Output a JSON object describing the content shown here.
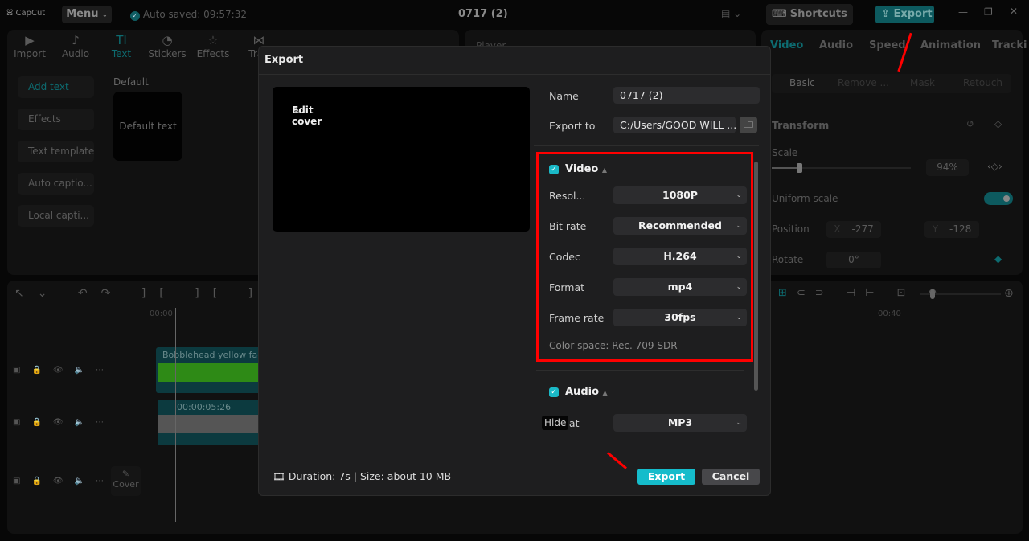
{
  "app": {
    "logo": "CapCut",
    "menu": "Menu",
    "autosave": "Auto saved: 09:57:32",
    "title": "0717 (2)",
    "shortcuts": "Shortcuts",
    "export": "Export",
    "accent": "#1ab9c7"
  },
  "toolbar": [
    {
      "label": "Import",
      "icon": "▶"
    },
    {
      "label": "Audio",
      "icon": "♪"
    },
    {
      "label": "Text",
      "icon": "TI"
    },
    {
      "label": "Stickers",
      "icon": "◔"
    },
    {
      "label": "Effects",
      "icon": "☆"
    },
    {
      "label": "Tran",
      "icon": "⋈"
    }
  ],
  "sidebar": [
    "Add text",
    "Effects",
    "Text template",
    "Auto captio...",
    "Local capti..."
  ],
  "text_panel": {
    "heading": "Default",
    "preset": "Default text"
  },
  "player": {
    "label": "Player"
  },
  "right": {
    "tabs": [
      "Video",
      "Audio",
      "Speed",
      "Animation",
      "Tracki"
    ],
    "subtabs": [
      "Basic",
      "Remove ...",
      "Mask",
      "Retouch"
    ],
    "transform": "Transform",
    "scale_label": "Scale",
    "scale_value": "94%",
    "scale": 0.94,
    "uniform_label": "Uniform scale",
    "uniform_on": true,
    "position_label": "Position",
    "x_label": "X",
    "x": "-277",
    "y_label": "Y",
    "y": "-128",
    "rotate_label": "Rotate",
    "rotate": "0°"
  },
  "timeline": {
    "time_start": "00:00",
    "time_40": "00:40",
    "clip1": "Bobblehead yellow fac",
    "clip2_time": "00:00:05:26",
    "cover": "Cover"
  },
  "dialog": {
    "title": "Export",
    "edit_cover": "Edit cover",
    "name_label": "Name",
    "name": "0717 (2)",
    "export_to_label": "Export to",
    "export_to": "C:/Users/GOOD WILL ...",
    "video": {
      "title": "Video",
      "enabled": true,
      "rows": [
        {
          "label": "Resol...",
          "value": "1080P"
        },
        {
          "label": "Bit rate",
          "value": "Recommended"
        },
        {
          "label": "Codec",
          "value": "H.264"
        },
        {
          "label": "Format",
          "value": "mp4"
        },
        {
          "label": "Frame rate",
          "value": "30fps"
        }
      ],
      "color_space": "Color space: Rec. 709 SDR"
    },
    "audio": {
      "title": "Audio",
      "enabled": true,
      "format_label": "nat",
      "format": "MP3",
      "tooltip": "Hide"
    },
    "footer": "Duration: 7s | Size: about 10 MB",
    "export": "Export",
    "cancel": "Cancel"
  },
  "annotation_color": "#ff0000"
}
